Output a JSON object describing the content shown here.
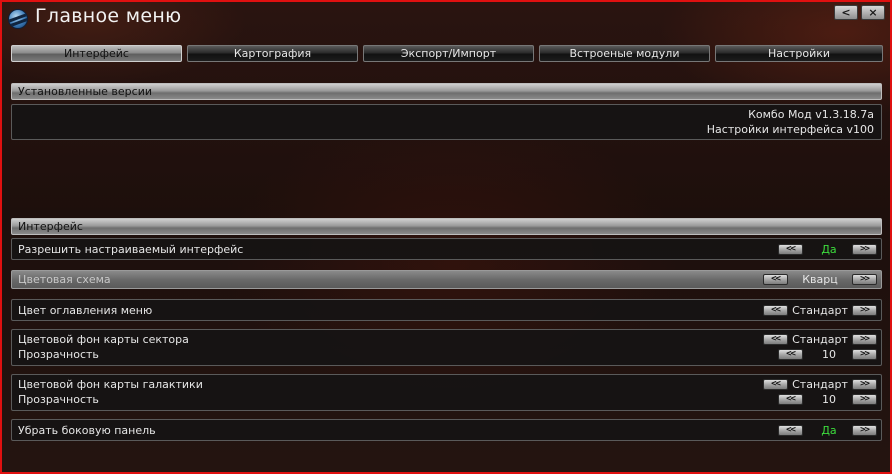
{
  "window": {
    "title": "Главное меню",
    "back_label": "<",
    "close_label": "×"
  },
  "tabs": [
    {
      "label": "Интерфейс",
      "active": true
    },
    {
      "label": "Картография",
      "active": false
    },
    {
      "label": "Экспорт/Импорт",
      "active": false
    },
    {
      "label": "Встроеные модули",
      "active": false
    },
    {
      "label": "Настройки",
      "active": false
    }
  ],
  "versions": {
    "header": "Установленные версии",
    "lines": [
      "Комбо Мод v1.3.18.7a",
      "Настройки интерфейса v100"
    ]
  },
  "interface": {
    "header": "Интерфейс",
    "prev_label": "<<",
    "next_label": ">>",
    "rows": {
      "custom_ui": {
        "label": "Разрешить настраиваемый интерфейс",
        "value": "Да"
      },
      "color_scheme": {
        "label": "Цветовая схема",
        "value": "Кварц"
      },
      "menu_header_color": {
        "label": "Цвет оглавления меню",
        "value": "Стандарт"
      },
      "sector_map_bg": {
        "label": "Цветовой фон карты сектора",
        "value": "Стандарт"
      },
      "sector_map_opacity": {
        "label": "Прозрачность",
        "value": "10"
      },
      "galaxy_map_bg": {
        "label": "Цветовой фон карты галактики",
        "value": "Стандарт"
      },
      "galaxy_map_opacity": {
        "label": "Прозрачность",
        "value": "10"
      },
      "hide_side_panel": {
        "label": "Убрать боковую панель",
        "value": "Да"
      }
    }
  },
  "colors": {
    "window_border": "#e01010",
    "enabled_value": "#3cdc3c"
  }
}
